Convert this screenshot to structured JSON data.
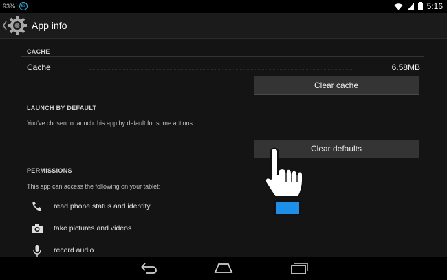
{
  "status_bar": {
    "battery_percent": "93%",
    "notification_badge": "63",
    "time": "5:16",
    "icons": [
      "wifi-icon",
      "signal-icon",
      "battery-icon"
    ]
  },
  "action_bar": {
    "title": "App info",
    "icon": "settings-gear-icon"
  },
  "cache": {
    "header": "CACHE",
    "label": "Cache",
    "value": "6.58MB",
    "clear_button": "Clear cache"
  },
  "launch_default": {
    "header": "LAUNCH BY DEFAULT",
    "description": "You've chosen to launch this app by default for some actions.",
    "clear_button": "Clear defaults"
  },
  "permissions": {
    "header": "PERMISSIONS",
    "description": "This app can access the following on your tablet:",
    "items": [
      {
        "icon": "phone-icon",
        "label": "read phone status and identity"
      },
      {
        "icon": "camera-icon",
        "label": "take pictures and videos"
      },
      {
        "icon": "microphone-icon",
        "label": "record audio"
      }
    ]
  },
  "nav_bar": {
    "buttons": [
      "back-icon",
      "home-icon",
      "recent-apps-icon"
    ]
  },
  "colors": {
    "accent": "#33b5e5",
    "background": "#141414",
    "button": "#343434"
  }
}
